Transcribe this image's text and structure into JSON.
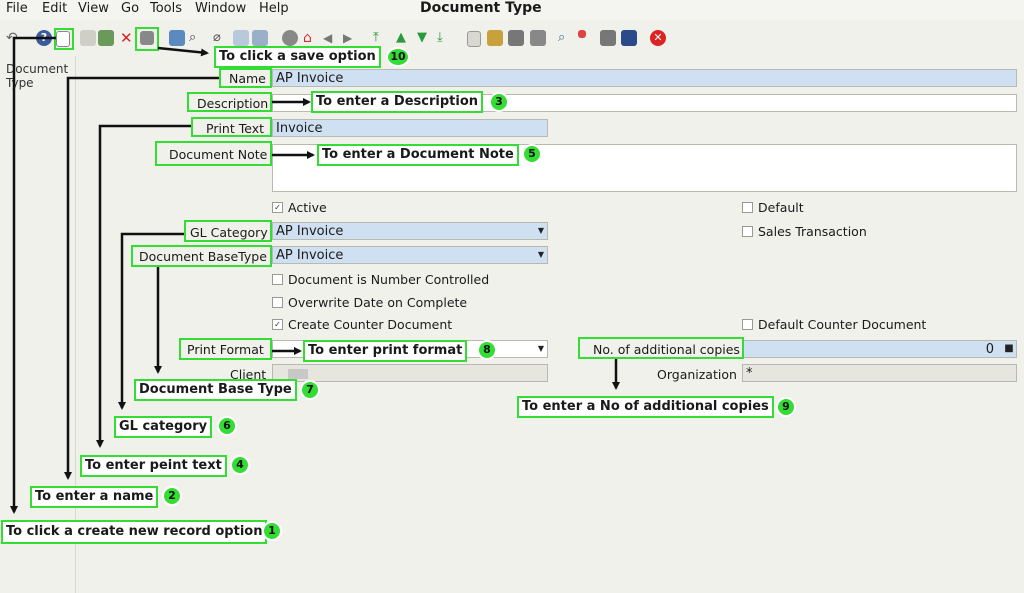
{
  "menu": {
    "file": "File",
    "edit": "Edit",
    "view": "View",
    "go": "Go",
    "tools": "Tools",
    "window": "Window",
    "help": "Help"
  },
  "window_title": "Document Type",
  "left_tab": "Document Type",
  "fields": {
    "name": {
      "label": "Name",
      "value": "AP Invoice"
    },
    "description": {
      "label": "Description",
      "value": ""
    },
    "print_text": {
      "label": "Print Text",
      "value": "Invoice"
    },
    "document_note": {
      "label": "Document Note",
      "value": ""
    },
    "gl_category": {
      "label": "GL Category",
      "value": "AP Invoice"
    },
    "doc_base_type": {
      "label": "Document BaseType",
      "value": "AP Invoice"
    },
    "print_format": {
      "label": "Print Format",
      "value": ""
    },
    "copies": {
      "label": "No. of additional copies",
      "value": "0"
    },
    "client": {
      "label": "Client",
      "value": ""
    },
    "organization": {
      "label": "Organization",
      "value": "*"
    }
  },
  "checkboxes": {
    "active": {
      "label": "Active",
      "checked": true
    },
    "default": {
      "label": "Default",
      "checked": false
    },
    "sales_transaction": {
      "label": "Sales Transaction",
      "checked": false
    },
    "number_controlled": {
      "label": "Document is Number Controlled",
      "checked": false
    },
    "overwrite_date": {
      "label": "Overwrite Date on Complete",
      "checked": false
    },
    "create_counter": {
      "label": "Create Counter Document",
      "checked": true
    },
    "default_counter": {
      "label": "Default Counter Document",
      "checked": false
    }
  },
  "annotations": {
    "a1": {
      "text": "To click a create new record option",
      "num": "1"
    },
    "a2": {
      "text": "To enter a name",
      "num": "2"
    },
    "a3": {
      "text": "To enter a Description",
      "num": "3"
    },
    "a4": {
      "text": "To enter peint text",
      "num": "4"
    },
    "a5": {
      "text": "To enter a Document Note",
      "num": "5"
    },
    "a6": {
      "text": "GL category",
      "num": "6"
    },
    "a7": {
      "text": "Document Base Type",
      "num": "7"
    },
    "a8": {
      "text": "To enter print format",
      "num": "8"
    },
    "a9": {
      "text": "To enter a No of additional copies",
      "num": "9"
    },
    "a10": {
      "text": "To click a save option",
      "num": "10"
    }
  },
  "colors": {
    "highlight": "#33dd33",
    "required_field": "#cfe0f2",
    "background": "#f1f1ec"
  }
}
